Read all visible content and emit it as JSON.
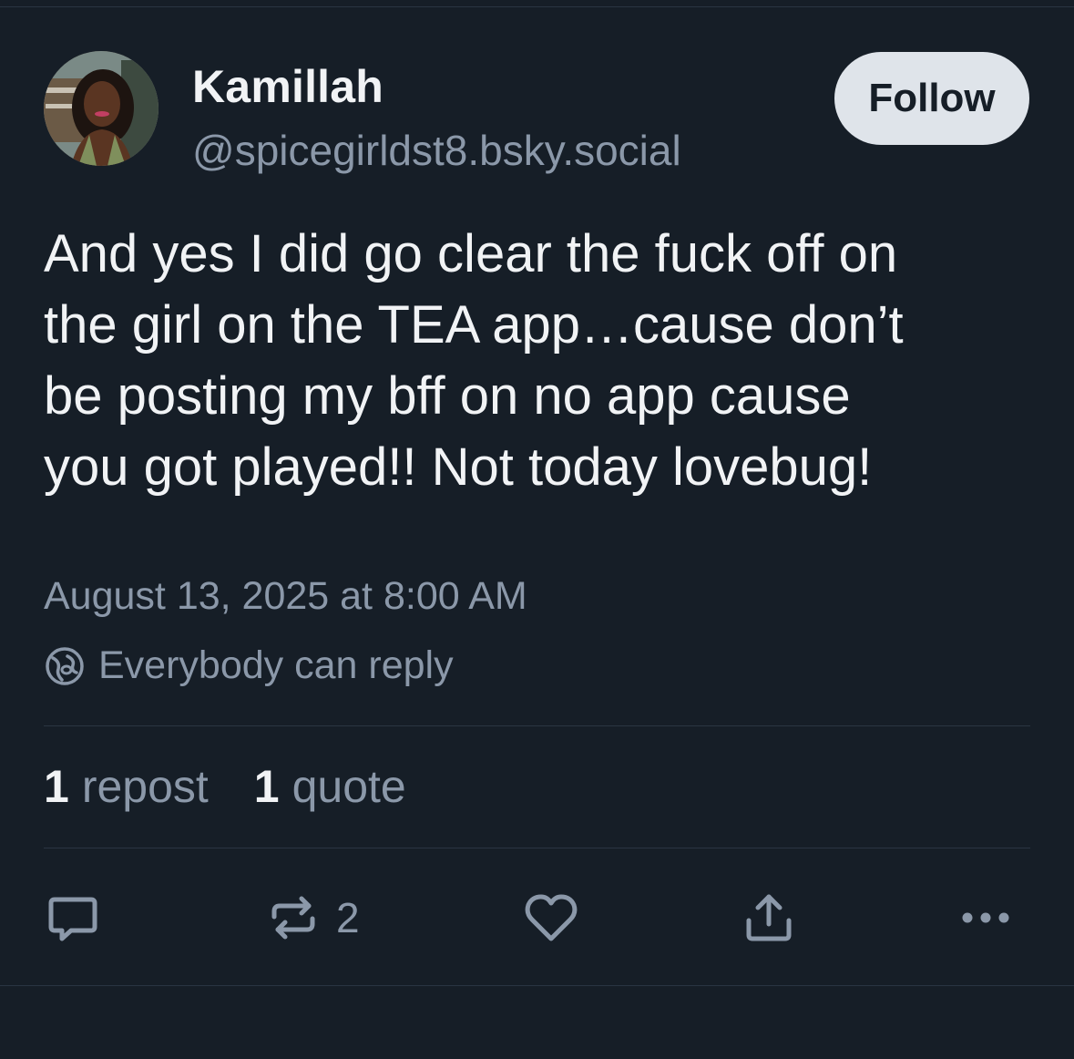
{
  "author": {
    "display_name": "Kamillah",
    "handle": "@spicegirldst8.bsky.social"
  },
  "follow_label": "Follow",
  "post": {
    "lines": [
      "And yes I did go clear the fuck off on",
      "the girl on the TEA app…cause don’t",
      "be posting my bff on no app cause",
      "you got played!! Not today lovebug!"
    ],
    "timestamp": "August 13, 2025 at 8:00 AM",
    "reply_setting": "Everybody can reply"
  },
  "counts": {
    "reposts": {
      "num": "1",
      "label": "repost"
    },
    "quotes": {
      "num": "1",
      "label": "quote"
    }
  },
  "actions": {
    "repost_count": "2"
  },
  "colors": {
    "background": "#161e27",
    "text": "#f1f3f5",
    "muted": "#8b98a9",
    "divider": "#2a3542",
    "follow_bg": "#dfe4ea"
  },
  "icons": [
    "globe-icon",
    "reply-icon",
    "repost-icon",
    "like-icon",
    "share-icon",
    "more-icon"
  ]
}
